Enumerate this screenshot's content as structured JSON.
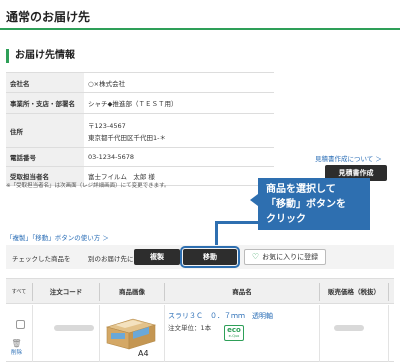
{
  "page": {
    "title": "通常のお届け先"
  },
  "section": {
    "heading": "お届け先情報"
  },
  "info": [
    {
      "key": "会社名",
      "value": "○×株式会社"
    },
    {
      "key": "事業所・支店・部署名",
      "value": "シャチ◆推進部（ＴＥＳＴ用）"
    },
    {
      "key": "住所",
      "value": "〒123-4567",
      "value2": "東京都千代田区千代田1-＊"
    },
    {
      "key": "電話番号",
      "value": "03-1234-5678"
    },
    {
      "key": "受取担当者名",
      "value": "富士フイルム　太郎 様"
    }
  ],
  "note": "※「受取担当者名」は次画面（レジ詳細画面）にて変更できます。",
  "quote": {
    "link": "見積書作成について ＞",
    "button": "見積書作成"
  },
  "callout": {
    "line1": "商品を選択して",
    "line2": "「移動」ボタンを",
    "line3": "クリック"
  },
  "howto": "「複製」「移動」ボタンの使い方 ＞",
  "actions": {
    "label1": "チェックした商品を",
    "label2": "別のお届け先に",
    "copy": "複製",
    "move": "移動",
    "favorite": "お気に入りに登録"
  },
  "table": {
    "headers": [
      "すべて",
      "注文コード",
      "商品画像",
      "商品名",
      "販売価格（税抜）"
    ],
    "row": {
      "delete": "削除",
      "name": "スラリ３Ｃ　０．７ｍｍ　透明軸",
      "unit": "注文単位：1本",
      "eco_top": "eco",
      "eco_bottom": "e-Quo",
      "image_label": "A4"
    }
  },
  "colors": {
    "accent_green": "#2e9f58",
    "callout_blue": "#2e6fb0",
    "dark_button": "#2d2d2d",
    "link_blue": "#2c6fb7"
  }
}
